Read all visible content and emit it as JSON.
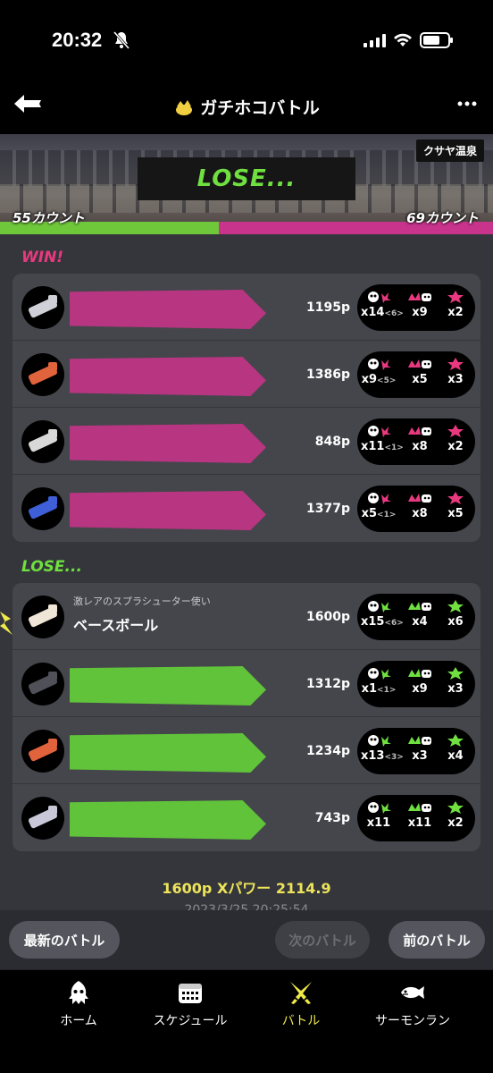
{
  "status_bar": {
    "time": "20:32"
  },
  "header": {
    "title": "ガチホコバトル"
  },
  "banner": {
    "stage_name": "クサヤ温泉",
    "result": "LOSE...",
    "our_count": "55カウント",
    "their_count": "69カウント"
  },
  "teams": {
    "win_label": "WIN!",
    "lose_label": "LOSE...",
    "win_players": [
      {
        "points": "1195p",
        "kills": "x14",
        "assists": "<6>",
        "specials_used": "x9",
        "special": "x2",
        "weapon_color": "#d0d0d8"
      },
      {
        "points": "1386p",
        "kills": "x9",
        "assists": "<5>",
        "specials_used": "x5",
        "special": "x3",
        "weapon_color": "#e0633c"
      },
      {
        "points": "848p",
        "kills": "x11",
        "assists": "<1>",
        "specials_used": "x8",
        "special": "x2",
        "weapon_color": "#d8d8d8"
      },
      {
        "points": "1377p",
        "kills": "x5",
        "assists": "<1>",
        "specials_used": "x8",
        "special": "x5",
        "weapon_color": "#3f5fd8"
      }
    ],
    "lose_players": [
      {
        "title": "激レアのスプラシューター使い",
        "name": "ベースボール",
        "points": "1600p",
        "kills": "x15",
        "assists": "<6>",
        "specials_used": "x4",
        "special": "x6",
        "weapon_color": "#f0e6d8"
      },
      {
        "points": "1312p",
        "kills": "x1",
        "assists": "<1>",
        "specials_used": "x9",
        "special": "x3",
        "weapon_color": "#505058"
      },
      {
        "points": "1234p",
        "kills": "x13",
        "assists": "<3>",
        "specials_used": "x3",
        "special": "x4",
        "weapon_color": "#e0633c"
      },
      {
        "points": "743p",
        "kills": "x11",
        "assists": "",
        "specials_used": "x11",
        "special": "x2",
        "weapon_color": "#c8c8d8"
      }
    ]
  },
  "footer": {
    "summary": "1600p  Xパワー 2114.9",
    "date": "2023/3/25 20:25:54"
  },
  "nav_actions": {
    "latest": "最新のバトル",
    "next": "次のバトル",
    "prev": "前のバトル"
  },
  "tabs": [
    {
      "label": "ホーム",
      "icon": "squid-icon"
    },
    {
      "label": "スケジュール",
      "icon": "calendar-icon"
    },
    {
      "label": "バトル",
      "icon": "battle-icon"
    },
    {
      "label": "サーモンラン",
      "icon": "salmon-icon"
    }
  ],
  "colors": {
    "win": "#e8397f",
    "lose": "#6fe040",
    "active_tab": "#f0e94a"
  }
}
